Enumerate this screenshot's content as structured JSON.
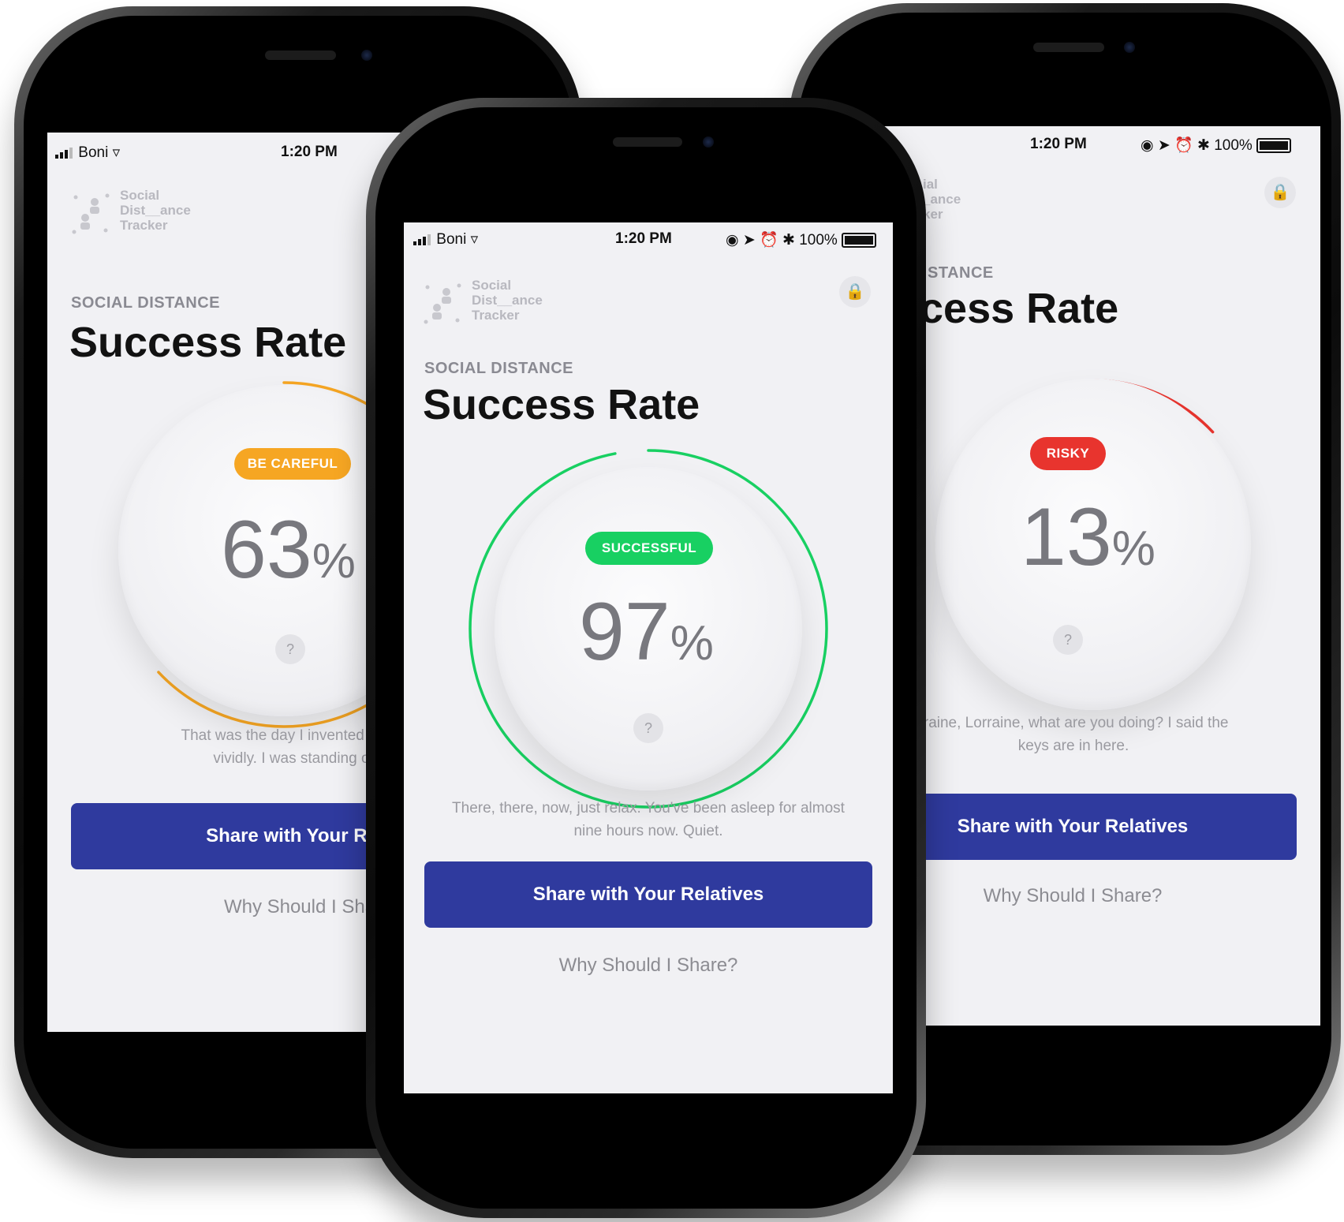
{
  "colors": {
    "careful": "#f6a623",
    "success": "#18d062",
    "risky": "#e8342e",
    "button": "#2f3a9e"
  },
  "status_bar": {
    "carrier": "Boni",
    "time": "1:20 PM",
    "battery": "100%"
  },
  "logo": {
    "line1": "Social",
    "line2": "Dist__ance",
    "line3": "Tracker"
  },
  "phones": {
    "left": {
      "eyebrow": "SOCIAL DISTANCE",
      "title": "Success Rate",
      "badge": "BE CAREFUL",
      "percent": "63",
      "percent_sign": "%",
      "help": "?",
      "progress": 0.63,
      "body_line1": "That was the day I invented time tra",
      "body_line2": "vividly. I was standing on t",
      "share_label": "Share with Your Rela",
      "why_label": "Why Should I Sha"
    },
    "center": {
      "eyebrow": "SOCIAL DISTANCE",
      "title": "Success Rate",
      "badge": "SUCCESSFUL",
      "percent": "97",
      "percent_sign": "%",
      "help": "?",
      "progress": 0.97,
      "body_line1": "There, there, now, just relax. You've been asleep for almost",
      "body_line2": "nine hours now. Quiet.",
      "share_label": "Share with Your Relatives",
      "why_label": "Why Should I Share?"
    },
    "right": {
      "logo_line1": "ial",
      "logo_line2": "_ance",
      "logo_line3": "ker",
      "eyebrow": "STANCE",
      "title": "cess Rate",
      "badge": "RISKY",
      "percent": "13",
      "percent_sign": "%",
      "help": "?",
      "progress": 0.13,
      "body_line1": "rraine, Lorraine, what are you doing? I said the",
      "body_line2": "keys are in here.",
      "share_label": "Share with Your Relatives",
      "why_label": "Why Should I Share?"
    }
  }
}
